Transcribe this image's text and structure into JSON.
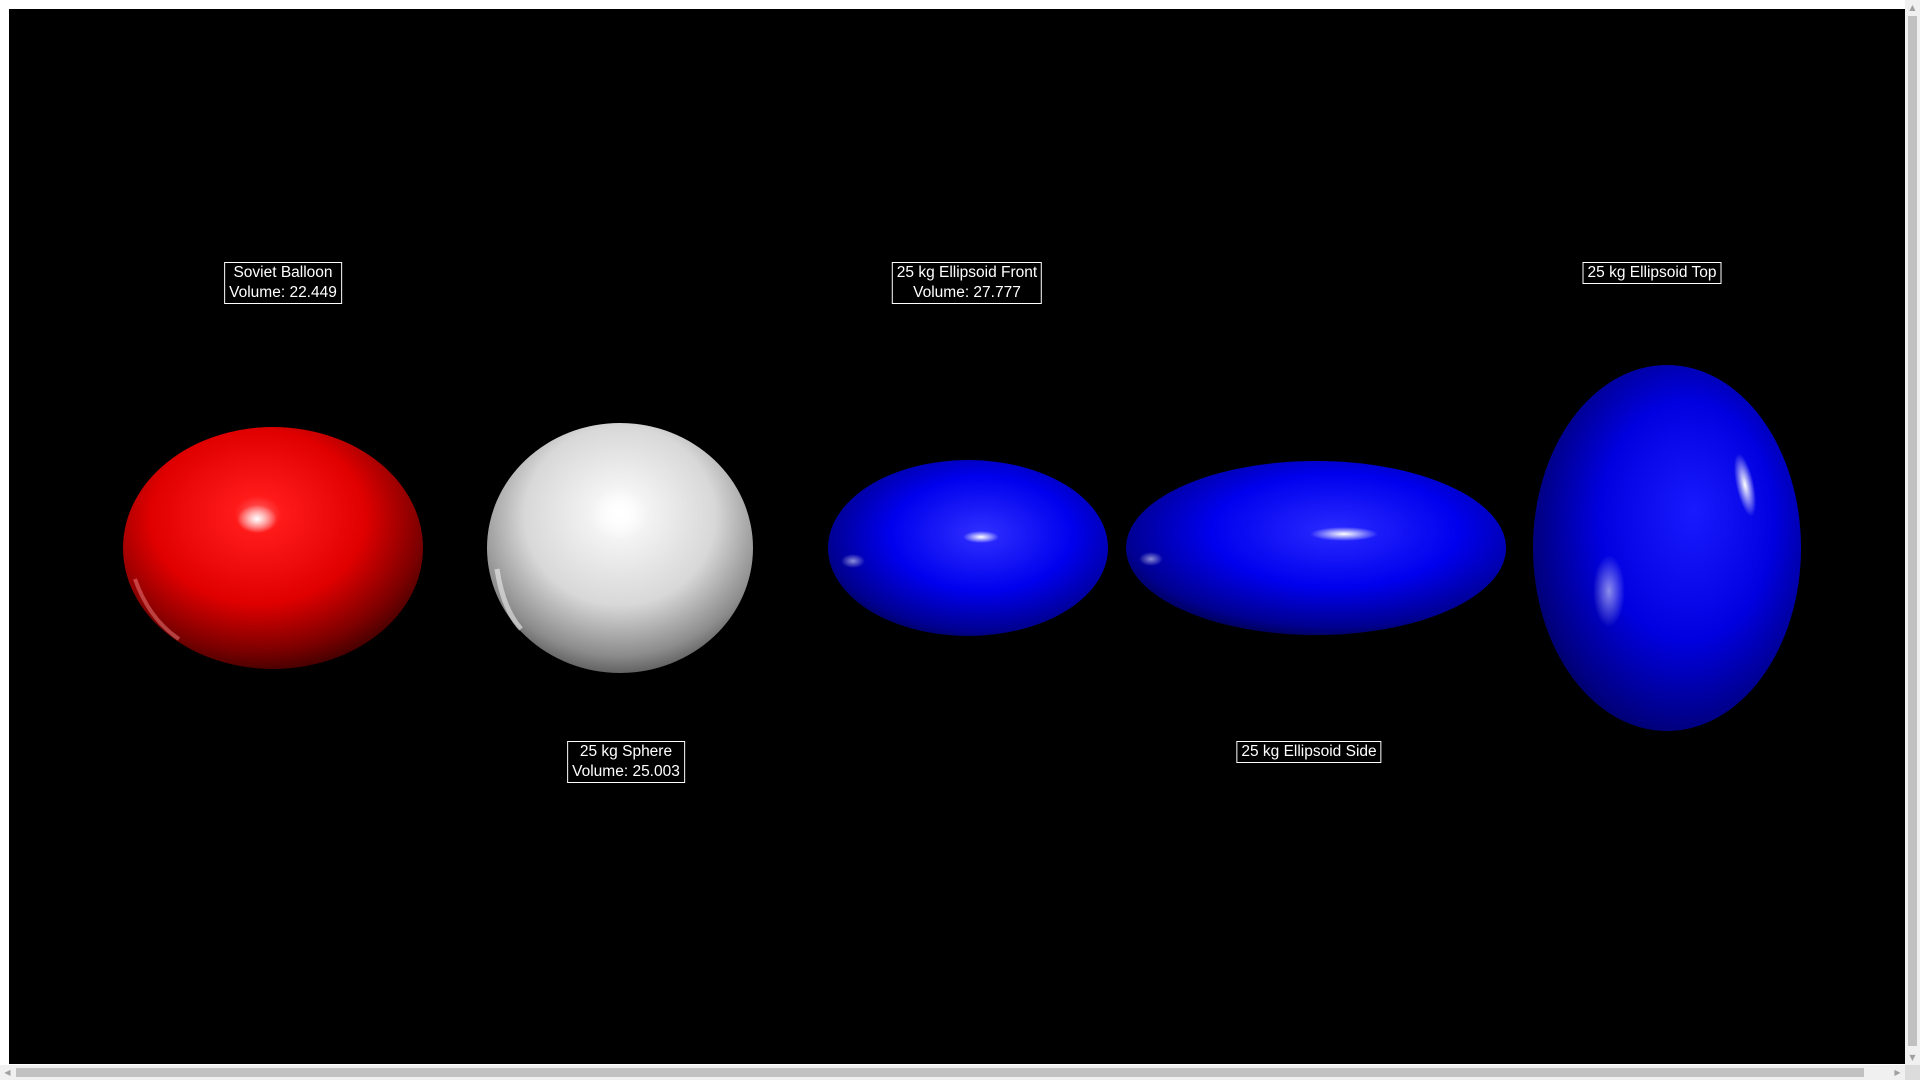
{
  "scene": {
    "background": "#000000",
    "objects": [
      {
        "id": "soviet-balloon",
        "color": "#ff0000",
        "label_lines": [
          "Soviet Balloon",
          "Volume: 22.449"
        ]
      },
      {
        "id": "sphere",
        "color": "#ffffff",
        "label_lines": [
          "25 kg Sphere",
          "Volume: 25.003"
        ]
      },
      {
        "id": "ellipsoid-front",
        "color": "#0000ff",
        "label_lines": [
          "25 kg Ellipsoid Front",
          "Volume: 27.777"
        ]
      },
      {
        "id": "ellipsoid-side",
        "color": "#0000ff",
        "label_lines": [
          "25 kg Ellipsoid Side"
        ]
      },
      {
        "id": "ellipsoid-top",
        "color": "#0000ff",
        "label_lines": [
          "25 kg Ellipsoid Top"
        ]
      }
    ]
  },
  "scrollbars": {
    "vertical": {
      "up_arrow": "▲",
      "down_arrow": "▼"
    },
    "horizontal": {
      "left_arrow": "◀",
      "right_arrow": "▶"
    }
  }
}
